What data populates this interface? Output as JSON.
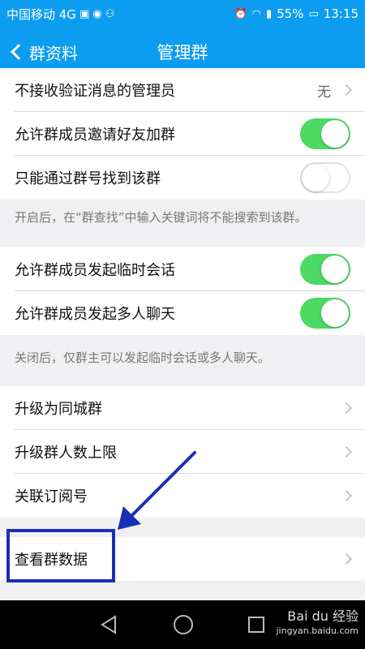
{
  "status_bar": {
    "carrier": "中国移动 4G",
    "battery": "55%",
    "time": "13:15"
  },
  "header": {
    "back_label": "群资料",
    "title": "管理群"
  },
  "rows": {
    "verify_admin": {
      "label": "不接收验证消息的管理员",
      "value": "无"
    },
    "allow_invite": {
      "label": "允许群成员邀请好友加群",
      "toggle": true
    },
    "only_by_number": {
      "label": "只能通过群号找到该群",
      "toggle": false
    },
    "temp_chat": {
      "label": "允许群成员发起临时会话",
      "toggle": true
    },
    "multi_chat": {
      "label": "允许群成员发起多人聊天",
      "toggle": true
    },
    "upgrade_city": {
      "label": "升级为同城群"
    },
    "upgrade_limit": {
      "label": "升级群人数上限"
    },
    "link_subscription": {
      "label": "关联订阅号"
    },
    "view_data": {
      "label": "查看群数据"
    }
  },
  "notes": {
    "search_note": "开启后，在“群查找”中输入关键词将不能搜索到该群。",
    "chat_note": "关闭后，仅群主可以发起临时会话或多人聊天。"
  },
  "watermark": {
    "brand": "Bai du 经验",
    "url": "jingyan.baidu.com"
  },
  "colors": {
    "accent": "#0d9df0",
    "toggle_on": "#4cd964",
    "highlight": "#1a2fb8"
  }
}
